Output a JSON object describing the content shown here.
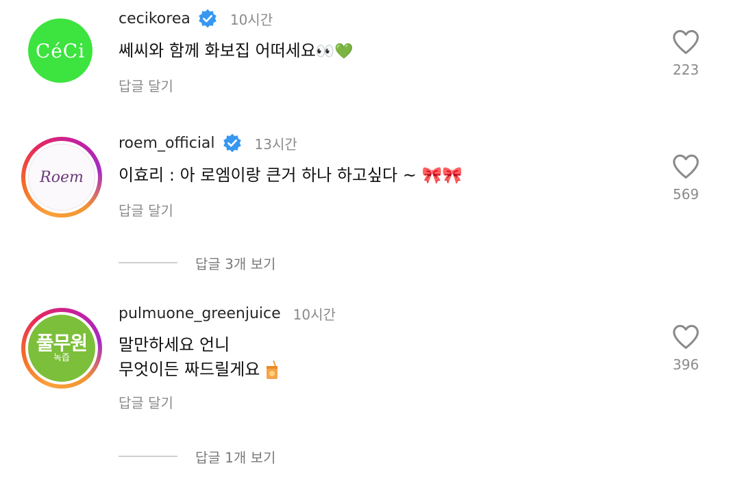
{
  "comments": [
    {
      "username": "cecikorea",
      "time": "10시간",
      "text": "쎄씨와 함께 화보집 어떠세요",
      "text_emoji": "👀💚",
      "reply_label": "답글 달기",
      "likes": "223",
      "avatar_text": "CéCi",
      "verified": true
    },
    {
      "username": "roem_official",
      "time": "13시간",
      "text": "이효리 : 아 로엠이랑 큰거 하나 하고싶다 ~",
      "text_emoji": "🎀🎀",
      "reply_label": "답글 달기",
      "likes": "569",
      "avatar_text": "Roem",
      "verified": true,
      "view_replies": "답글 3개 보기"
    },
    {
      "username": "pulmuone_greenjuice",
      "time": "10시간",
      "text_line1": "말만하세요 언니",
      "text_line2": "무엇이든 짜드릴게요",
      "reply_label": "답글 달기",
      "likes": "396",
      "avatar_text": "풀무원",
      "avatar_sub": "녹즙",
      "verified": false,
      "view_replies": "답글 1개 보기"
    }
  ],
  "colors": {
    "verified": "#3897f0",
    "muted_text": "#8a8a8a",
    "ceci_green": "#3de33f",
    "pulmuone_green": "#7cbf3a"
  }
}
